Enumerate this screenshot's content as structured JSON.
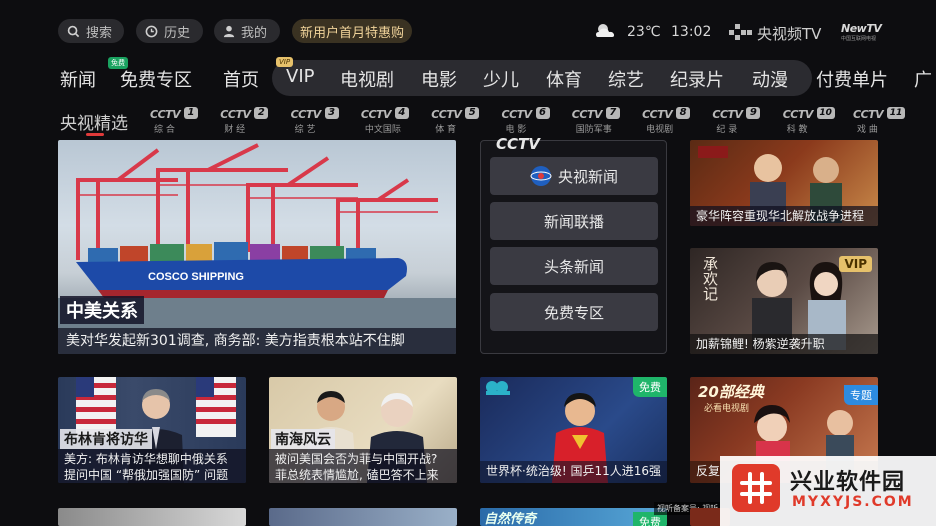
{
  "topbar": {
    "search_label": "搜索",
    "history_label": "历史",
    "mine_label": "我的",
    "promo_label": "新用户首月特惠购",
    "temperature": "23℃",
    "time": "13:02",
    "brand_label": "央视频TV",
    "newtv_label": "NewTV",
    "newtv_sub": "中国互联网电视"
  },
  "nav": {
    "items": [
      "新闻",
      "免费专区",
      "首页",
      "VIP",
      "电视剧",
      "电影",
      "少儿",
      "体育",
      "综艺",
      "纪录片",
      "动漫",
      "付费单片",
      "广"
    ],
    "free_badge": "免费",
    "vip_badge": "VIP"
  },
  "channels": {
    "selected_label": "央视精选",
    "items": [
      {
        "num": "1",
        "sub": "综 合"
      },
      {
        "num": "2",
        "sub": "财 经"
      },
      {
        "num": "3",
        "sub": "综 艺"
      },
      {
        "num": "4",
        "sub": "中文国际"
      },
      {
        "num": "5",
        "sub": "体 育"
      },
      {
        "num": "6",
        "sub": "电 影"
      },
      {
        "num": "7",
        "sub": "国防军事"
      },
      {
        "num": "8",
        "sub": "电视剧"
      },
      {
        "num": "9",
        "sub": "纪 录"
      },
      {
        "num": "10",
        "sub": "科 教"
      },
      {
        "num": "11",
        "sub": "戏 曲"
      }
    ],
    "logo_text": "CCTV"
  },
  "hero": {
    "tag": "中美关系",
    "caption": "美对华发起新301调查, 商务部: 美方指责根本站不住脚",
    "ship_text": "COSCO SHIPPING"
  },
  "menu": {
    "logo_text": "CCTV",
    "buttons": [
      "央视新闻",
      "新闻联播",
      "头条新闻",
      "免费专区"
    ]
  },
  "right_cards": [
    {
      "caption": "豪华阵容重现华北解放战争进程",
      "badge": ""
    },
    {
      "caption": "加薪锦鲤! 杨紫逆袭升职",
      "badge": "VIP",
      "title_art": "承欢记"
    }
  ],
  "row2": [
    {
      "tag": "布林肯将访华",
      "caption1": "美方: 布林肯访华想聊中俄关系",
      "caption2": "提问中国 “帮俄加强国防” 问题"
    },
    {
      "tag": "南海风云",
      "caption1": "被问美国会否为菲与中国开战?",
      "caption2": "菲总统表情尴尬, 磕巴答不上来"
    },
    {
      "badge": "免费",
      "caption1": "世界杯·统治级! 国乒11人进16强"
    },
    {
      "badge": "专题",
      "title_art": "20部经典",
      "title_art2": "必看电视剧",
      "caption1": "反复"
    }
  ],
  "row3": {
    "nature_label": "自然传奇",
    "badge": "免费",
    "filing": "视听备案号: 视听"
  },
  "watermark": {
    "title": "兴业软件园",
    "url": "MYXYJS.COM"
  },
  "colors": {
    "background": "#0d0d10",
    "accent_red": "#e03a3a",
    "free_green": "#1fb56a",
    "vip_gold": "#e6c16b",
    "topic_blue": "#2d8be0"
  }
}
